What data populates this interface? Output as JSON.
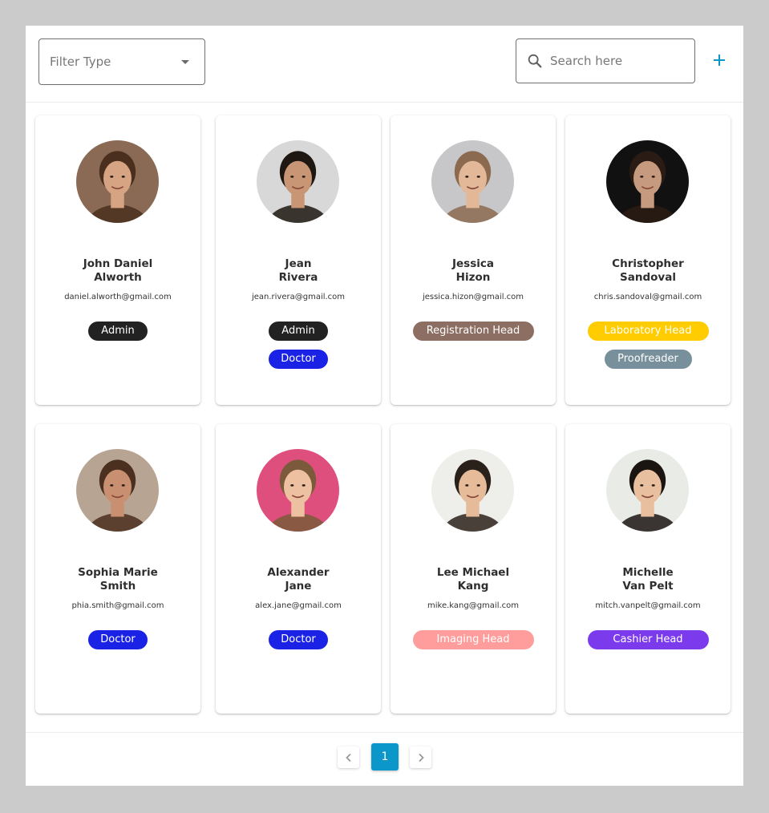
{
  "toolbar": {
    "filter_label": "Filter Type",
    "search_placeholder": "Search here",
    "add_icon": "plus-icon",
    "accent_color": "#0b97c9"
  },
  "users": [
    {
      "first": "John Daniel",
      "last": "Alworth",
      "email": "daniel.alworth@gmail.com",
      "avatar_bg": "#8a6a55",
      "skin": "#d6a483",
      "hair": "#4a2f1e",
      "roles": [
        {
          "label": "Admin",
          "bg": "#222222",
          "fg": "#ffffff"
        }
      ]
    },
    {
      "first": "Jean",
      "last": "Rivera",
      "email": "jean.rivera@gmail.com",
      "avatar_bg": "#d8d8d8",
      "skin": "#c99675",
      "hair": "#1e1712",
      "roles": [
        {
          "label": "Admin",
          "bg": "#222222",
          "fg": "#ffffff"
        },
        {
          "label": "Doctor",
          "bg": "#1a22e6",
          "fg": "#ffffff"
        }
      ]
    },
    {
      "first": "Jessica",
      "last": "Hizon",
      "email": "jessica.hizon@gmail.com",
      "avatar_bg": "#c7c7c9",
      "skin": "#e2b898",
      "hair": "#8b6a50",
      "roles": [
        {
          "label": "Registration Head",
          "bg": "#8d6e63",
          "fg": "#ffffff"
        }
      ]
    },
    {
      "first": "Christopher",
      "last": "Sandoval",
      "email": "chris.sandoval@gmail.com",
      "avatar_bg": "#111111",
      "skin": "#c69a7e",
      "hair": "#2a1c14",
      "roles": [
        {
          "label": "Laboratory Head",
          "bg": "#ffcc00",
          "fg": "#ffffff"
        },
        {
          "label": "Proofreader",
          "bg": "#78909c",
          "fg": "#ffffff"
        }
      ]
    },
    {
      "first": "Sophia Marie",
      "last": "Smith",
      "email": "phia.smith@gmail.com",
      "avatar_bg": "#b7a493",
      "skin": "#c89070",
      "hair": "#4b2f1f",
      "roles": [
        {
          "label": "Doctor",
          "bg": "#1a22e6",
          "fg": "#ffffff"
        }
      ]
    },
    {
      "first": "Alexander",
      "last": "Jane",
      "email": "alex.jane@gmail.com",
      "avatar_bg": "#df4f7d",
      "skin": "#eec0a2",
      "hair": "#7a5a3a",
      "roles": [
        {
          "label": "Doctor",
          "bg": "#1a22e6",
          "fg": "#ffffff"
        }
      ]
    },
    {
      "first": "Lee Michael",
      "last": "Kang",
      "email": "mike.kang@gmail.com",
      "avatar_bg": "#eeeeea",
      "skin": "#e6bb9a",
      "hair": "#2b211b",
      "roles": [
        {
          "label": "Imaging Head",
          "bg": "#ff9d9d",
          "fg": "#ffffff"
        }
      ]
    },
    {
      "first": "Michelle",
      "last": "Van Pelt",
      "email": "mitch.vanpelt@gmail.com",
      "avatar_bg": "#e9ece6",
      "skin": "#e8bf9f",
      "hair": "#1b1512",
      "roles": [
        {
          "label": "Cashier Head",
          "bg": "#7c3aed",
          "fg": "#ffffff"
        }
      ]
    }
  ],
  "pagination": {
    "current_page": "1",
    "prev_icon": "chevron-left-icon",
    "next_icon": "chevron-right-icon"
  }
}
